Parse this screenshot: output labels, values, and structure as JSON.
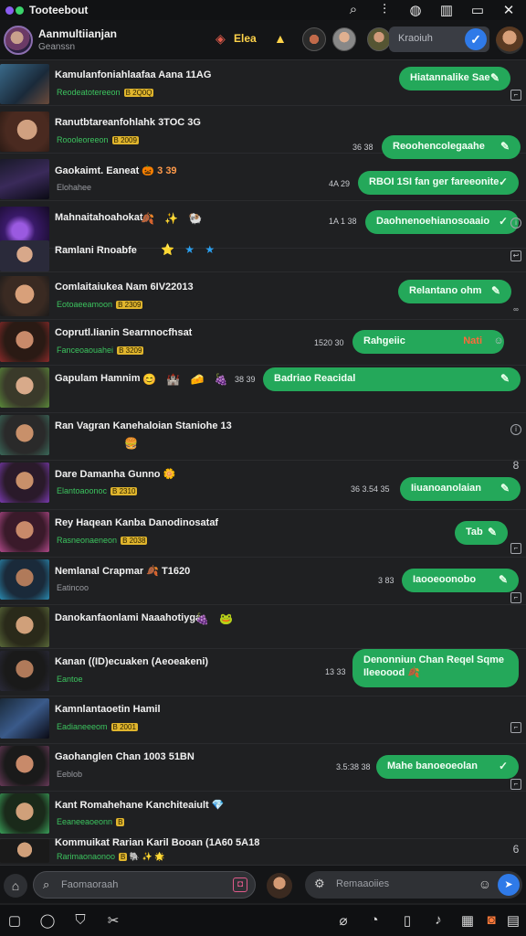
{
  "app": {
    "title": "Tooteebout"
  },
  "header": {
    "name": "Aanmultiianjan",
    "subtitle": "Geanssn",
    "tag": "Elea",
    "search_text": "Kraoiuh"
  },
  "chats": [
    {
      "title": "Kamulanfoniahlaafaa Aana 11AG",
      "meta": "Reodeatotereeon",
      "badge": "B 2Q0Q",
      "bubble": "Hiatannalike Sae",
      "title_green": false
    },
    {
      "title": "Ranutbtareanfohlahk 3TOC 3G",
      "meta": "Roooleoreeon",
      "badge": "B 2009",
      "bubble": "Reoohencolegaahe",
      "time": "36 38"
    },
    {
      "title": "Gaokaimt. Eaneat",
      "meta": "Elohahee",
      "emoji": "🎃 3 39",
      "bubble": "RBOI 1SI fan ger fareeonite",
      "time": "4A 29"
    },
    {
      "title": "Mahnaitahoahokat",
      "meta": "",
      "emoji": "🍂 ✨ 🐏",
      "bubble": "Daohnenoehianosoaaio",
      "time": "1A 1 38"
    },
    {
      "title": "Ramlani Rnoabfe",
      "meta": "",
      "emoji": "⭐ ★ ★",
      "bubble": "",
      "time": ""
    },
    {
      "title": "Comlaitaiukea Nam 6IV22013",
      "meta": "Eotoaeeamoon",
      "badge": "B 2309",
      "bubble": "Relantano ohm",
      "time": ""
    },
    {
      "title": "Coprutl.Iianin Searnnocfhsat",
      "meta": "Fanceoaouahei",
      "badge": "B 3209",
      "bubble": "Rahgeiic",
      "time": "1520 30",
      "bubble_extra": "Nati"
    },
    {
      "title": "Gapulam Hamnim",
      "meta": "",
      "emoji": "😊 🏰 🧀 🍇",
      "bubble": "Badriao Reacidal",
      "time": "38 39"
    },
    {
      "title": "Ran Vagran Kanehaloian Staniohe 13",
      "meta": "",
      "emoji": "🍔",
      "bubble": "",
      "time": ""
    },
    {
      "title": "Dare Damanha Gunno",
      "meta": "Elantoaoonoc",
      "badge": "B 2310",
      "emoji": "🌼",
      "bubble": "Iiuanoanolaian",
      "time": "36 3.54 35"
    },
    {
      "title": "Rey Haqean Kanba Danodinosataf",
      "meta": "Rasneonaeneon",
      "badge": "B 2038",
      "bubble": "Tab",
      "time": ""
    },
    {
      "title": "Nemlanal Crapmar 🍂 T1620",
      "meta": "Eatincoo",
      "bubble": "Iaooeoonobo",
      "time": "3 83"
    },
    {
      "title": "Danokanfaonlami Naaahotiyga",
      "meta": "",
      "emoji": "🍇 🐸",
      "bubble": "",
      "time": ""
    },
    {
      "title": "Kanan ((ID)ecuaken (Aeoeakeni)",
      "meta": "Eantoe",
      "emoji": "",
      "bubble": "Denonniun Chan Reqel Sqme Ileeoood 🍂",
      "time": "13 33",
      "title_green": true
    },
    {
      "title": "Kamnlantaoetin Hamil",
      "meta": "Eadianeeeom",
      "badge": "B 2001",
      "bubble": "",
      "time": ""
    },
    {
      "title": "Gaohanglen Chan 1003 51BN",
      "meta": "Eeblob",
      "bubble": "Mahe banoeoeolan",
      "time": "3.5:38 38"
    },
    {
      "title": "Kant Romahehane Kanchiteaiult",
      "meta": "Eeaneeaoeonn",
      "badge": "B",
      "emoji": "💎",
      "bubble": "",
      "time": ""
    },
    {
      "title": "Kommuikat Rarian Karil Booan (1A60 5A18",
      "meta": "Rarimaonaonoo",
      "badge": "B",
      "emoji": "🐘 ✨ 🌟",
      "bubble": "",
      "time": ""
    }
  ],
  "composer": {
    "placeholder_left": "Faomaoraah",
    "placeholder_right": "Remaaoiies"
  },
  "colors": {
    "bubble": "#24a85a",
    "accent_blue": "#2f7ae8",
    "meta_green": "#3cc45f"
  }
}
